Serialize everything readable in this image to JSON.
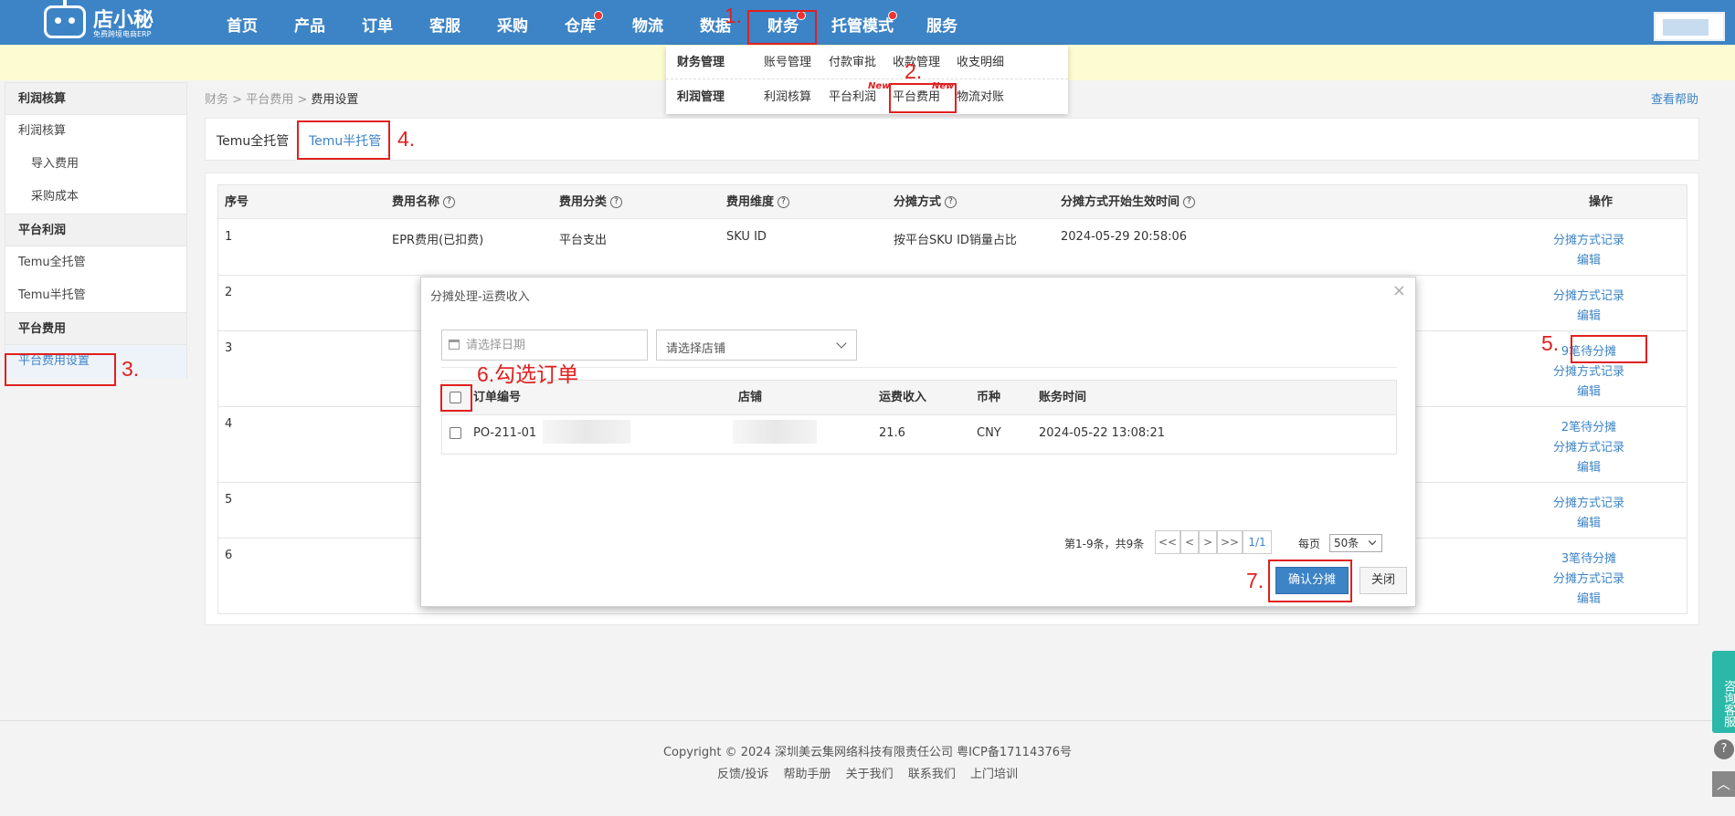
{
  "nav": {
    "brand": "店小秘",
    "slogan": "免费跨境电商ERP",
    "items": [
      {
        "label": "首页",
        "dot": false
      },
      {
        "label": "产品",
        "dot": false
      },
      {
        "label": "订单",
        "dot": false
      },
      {
        "label": "客服",
        "dot": false
      },
      {
        "label": "采购",
        "dot": false
      },
      {
        "label": "仓库",
        "dot": true
      },
      {
        "label": "物流",
        "dot": false
      },
      {
        "label": "数据",
        "dot": false
      },
      {
        "label": "财务",
        "dot": true
      },
      {
        "label": "托管模式",
        "dot": true
      },
      {
        "label": "服务",
        "dot": false
      }
    ]
  },
  "dropdown": {
    "groups": [
      {
        "title": "财务管理",
        "items": [
          "账号管理",
          "付款审批",
          "收款管理",
          "收支明细"
        ]
      },
      {
        "title": "利润管理",
        "items": [
          "利润核算",
          "平台利润",
          "平台费用",
          "物流对账"
        ]
      }
    ],
    "new_tag": "New"
  },
  "sidebar": {
    "sections": [
      {
        "title": "利润核算",
        "items": [
          {
            "label": "利润核算",
            "sub": false
          },
          {
            "label": "导入费用",
            "sub": true
          },
          {
            "label": "采购成本",
            "sub": true
          }
        ]
      },
      {
        "title": "平台利润",
        "items": [
          {
            "label": "Temu全托管",
            "sub": false
          },
          {
            "label": "Temu半托管",
            "sub": false
          }
        ]
      },
      {
        "title": "平台费用",
        "items": [
          {
            "label": "平台费用设置",
            "sub": false,
            "active": true
          }
        ]
      }
    ]
  },
  "breadcrumb": {
    "items": [
      "财务",
      "平台费用",
      "费用设置"
    ],
    "sep": ">"
  },
  "help_link": "查看帮助",
  "tabs": [
    {
      "label": "Temu全托管",
      "active": false
    },
    {
      "label": "Temu半托管",
      "active": true
    }
  ],
  "table": {
    "headers": [
      "序号",
      "费用名称",
      "费用分类",
      "费用维度",
      "分摊方式",
      "分摊方式开始生效时间",
      "操作"
    ],
    "header_help": [
      false,
      true,
      true,
      true,
      true,
      true,
      false
    ],
    "rows": [
      {
        "no": "1",
        "name": "EPR费用(已扣费)",
        "category": "平台支出",
        "dimension": "SKU ID",
        "method": "按平台SKU ID销量占比",
        "time": "2024-05-29 20:58:06",
        "ops": [
          "分摊方式记录",
          "编辑"
        ]
      },
      {
        "no": "2",
        "name": "",
        "category": "",
        "dimension": "",
        "method": "",
        "time": "",
        "ops": [
          "分摊方式记录",
          "编辑"
        ]
      },
      {
        "no": "3",
        "name": "",
        "category": "",
        "dimension": "",
        "method": "",
        "time": "",
        "ops": [
          "9笔待分摊",
          "分摊方式记录",
          "编辑"
        ]
      },
      {
        "no": "4",
        "name": "",
        "category": "",
        "dimension": "",
        "method": "",
        "time": "",
        "ops": [
          "2笔待分摊",
          "分摊方式记录",
          "编辑"
        ]
      },
      {
        "no": "5",
        "name": "",
        "category": "",
        "dimension": "",
        "method": "",
        "time": "",
        "ops": [
          "分摊方式记录",
          "编辑"
        ]
      },
      {
        "no": "6",
        "name": "",
        "category": "",
        "dimension": "",
        "method": "",
        "time": "",
        "ops": [
          "3笔待分摊",
          "分摊方式记录",
          "编辑"
        ]
      }
    ]
  },
  "modal": {
    "title": "分摊处理-运费收入",
    "close": "×",
    "date_placeholder": "请选择日期",
    "shop_placeholder": "请选择店铺",
    "headers": [
      "订单编号",
      "店铺",
      "运费收入",
      "币种",
      "账务时间"
    ],
    "rows": [
      {
        "order": "PO-211-01",
        "shop": "",
        "freight": "21.6",
        "currency": "CNY",
        "time": "2024-05-22 13:08:21"
      }
    ],
    "pager": {
      "summary": "第1-9条，共9条",
      "first": "<<",
      "prev": "<",
      "next": ">",
      "last": ">>",
      "page": "1/1",
      "per_label": "每页",
      "per_value": "50条"
    },
    "confirm": "确认分摊",
    "cancel": "关闭"
  },
  "annotations": [
    "1.",
    "2.",
    "3.",
    "4.",
    "5.",
    "6.勾选订单",
    "7."
  ],
  "footer": {
    "copyright": "Copyright © 2024 深圳美云集网络科技有限责任公司  粤ICP备17114376号",
    "links": [
      "反馈/投诉",
      "帮助手册",
      "关于我们",
      "联系我们",
      "上门培训"
    ]
  },
  "float": {
    "cs": "咨询客服",
    "help": "?",
    "top": "︿"
  },
  "colors": {
    "primary": "#3d84c6",
    "annotation": "#e0201f",
    "notice": "#fdfbd2",
    "cs": "#2bb8a8"
  }
}
